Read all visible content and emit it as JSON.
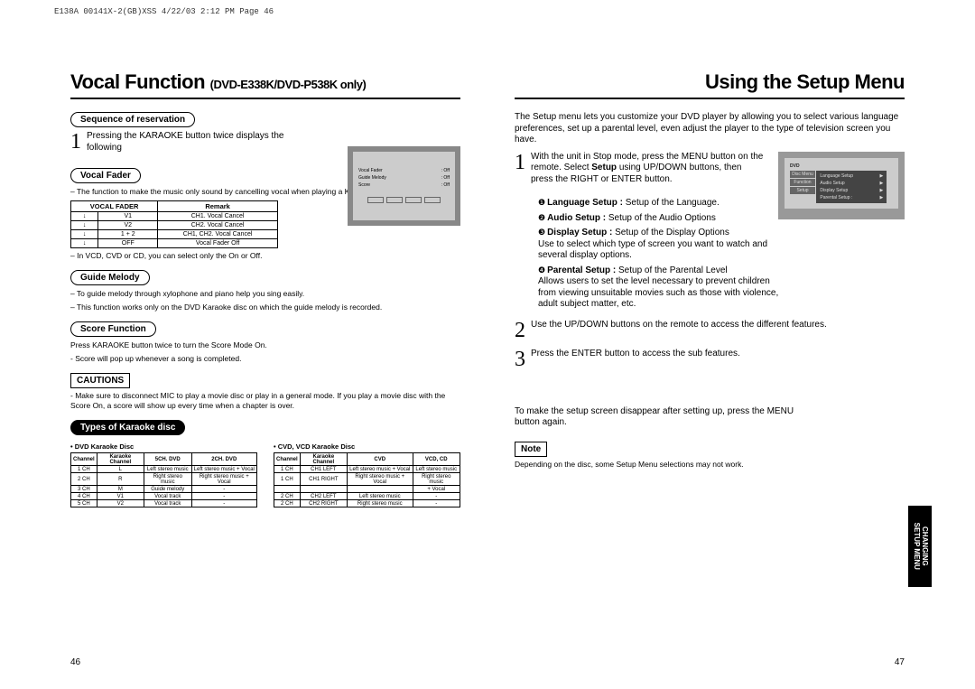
{
  "header_print": "E138A 00141X-2(GB)XSS  4/22/03 2:12 PM  Page 46",
  "left": {
    "title": "Vocal Function",
    "title_small": "DVD-E338K/DVD-P538K only)",
    "seq": {
      "label": "Sequence of reservation",
      "step": "1",
      "text": "Pressing the KARAOKE button twice displays the following"
    },
    "vf": {
      "label": "Vocal Fader",
      "desc": "– The function to make the music only sound by cancelling vocal when playing a Karaoke disc.",
      "th1": "VOCAL FADER",
      "th2": "Remark",
      "r1a": "↓",
      "r1b": "V1",
      "r1c": "CH1. Vocal Cancel",
      "r2a": "↓",
      "r2b": "V2",
      "r2c": "CH2. Vocal Cancel",
      "r3a": "↓",
      "r3b": "1 + 2",
      "r3c": "CH1, CH2. Vocal Cancel",
      "r4a": "↓",
      "r4b": "OFF",
      "r4c": "Vocal Fader Off",
      "note": "– In VCD, CVD or CD, you can select only the On or Off."
    },
    "gm": {
      "label": "Guide Melody",
      "d1": "– To guide melody through xylophone and piano help you sing easily.",
      "d2": "– This function works only on the DVD Karaoke disc on which the guide melody is recorded."
    },
    "sf": {
      "label": "Score Function",
      "d1": "Press KARAOKE button twice to turn the Score Mode On.",
      "d2": "- Score will pop up whenever a song is completed."
    },
    "cautions": {
      "label": "CAUTIONS",
      "d1": "- Make sure to disconnect MIC to play a movie disc or play in a general mode.  If you play a movie disc with the Score On, a score will show up every time when a chapter is over."
    },
    "types": {
      "label": "Types of Karaoke disc",
      "t1cap": "• DVD Karaoke Disc",
      "t2cap": "• CVD, VCD Karaoke Disc",
      "t1": {
        "h1": "Channel",
        "h2": "Karaoke Channel",
        "h3": "5CH. DVD",
        "h4": "2CH. DVD",
        "r1": [
          "1 CH",
          "L",
          "Left stereo music",
          "Left stereo music + Vocal"
        ],
        "r2": [
          "2 CH",
          "R",
          "Right stereo music",
          "Right stereo music + Vocal"
        ],
        "r3": [
          "3 CH",
          "M",
          "Guide melody",
          "-"
        ],
        "r4": [
          "4 CH",
          "V1",
          "Vocal track",
          "-"
        ],
        "r5": [
          "5 CH",
          "V2",
          "Vocal track",
          "-"
        ]
      },
      "t2": {
        "h1": "Channel",
        "h2": "Karaoke Channel",
        "h3": "CVD",
        "h4": "VCD, CD",
        "r1": [
          "1 CH",
          "CH1 LEFT",
          "Left stereo music + Vocal",
          "Left stereo music"
        ],
        "r2": [
          "1 CH",
          "CH1 RIGHT",
          "Right stereo music + Vocal",
          "Right stereo music"
        ],
        "r3": [
          "",
          "",
          "",
          "+ Vocal"
        ],
        "r4": [
          "2 CH",
          "CH2 LEFT",
          "Left stereo music",
          "-"
        ],
        "r5": [
          "2 CH",
          "CH2 RIGHT",
          "Right stereo music",
          "-"
        ]
      }
    },
    "osd": {
      "l1": "Vocal   Fader",
      "l2": "Guide  Melody",
      "l3": "Score",
      "off": ": Off"
    },
    "page": "46"
  },
  "right": {
    "title": "Using the Setup Menu",
    "intro": "The Setup menu lets you customize your DVD player by allowing you to select various language preferences, set up a parental level, even adjust the player to the type of television screen you have.",
    "s1": {
      "n": "1",
      "text_a": "With the unit in Stop mode, press the MENU button on the remote. Select ",
      "text_b": "Setup",
      "text_c": " using UP/DOWN buttons, then press the RIGHT or ENTER button."
    },
    "items": {
      "i1_b": "Language Setup :",
      "i1_t": " Setup of the Language.",
      "i2_b": "Audio Setup :",
      "i2_t": " Setup of the Audio Options",
      "i3_b": "Display Setup :",
      "i3_t": " Setup of the Display Options",
      "i3_x": "Use to select which type of screen you want to watch and several display options.",
      "i4_b": "Parental Setup :",
      "i4_t": " Setup of the Parental Level",
      "i4_x": "Allows users to set the level necessary to prevent children from viewing unsuitable movies such as those with violence, adult subject matter, etc."
    },
    "s2": {
      "n": "2",
      "t": "Use the UP/DOWN buttons on the remote to access the different features."
    },
    "s3": {
      "n": "3",
      "t": "Press the ENTER button to access the sub features."
    },
    "footer": "To make the setup screen disappear after setting up, press the MENU button again.",
    "note_label": "Note",
    "note_text": "Depending on the disc, some Setup Menu selections may not work.",
    "tv": {
      "t": "DVD",
      "m1": "Language Setup",
      "m2": "Audio Setup",
      "m3": "Display Setup",
      "m4": "Parental Setup :",
      "s1": "Disc Menu",
      "s2": "Function",
      "s3": "Setup"
    },
    "page": "47",
    "tab": "CHANGING\nSETUP MENU"
  }
}
